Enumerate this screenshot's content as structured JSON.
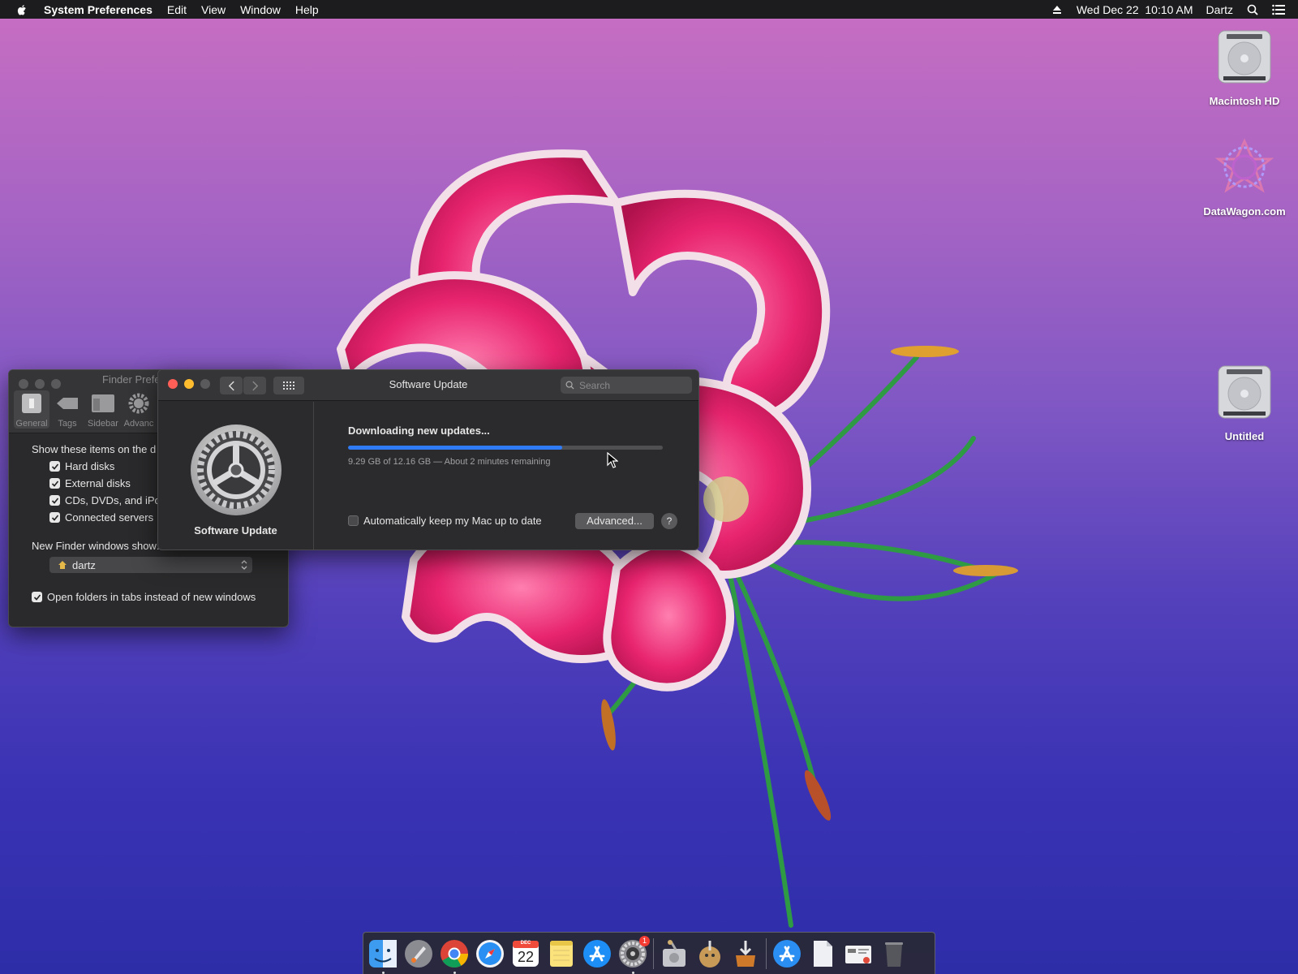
{
  "menubar": {
    "app_name": "System Preferences",
    "items": [
      "Edit",
      "View",
      "Window",
      "Help"
    ],
    "datetime": "Wed Dec 22  10:10 AM",
    "user": "Dartz"
  },
  "desktop": {
    "icons": [
      {
        "label": "Macintosh HD",
        "icon": "hard-drive-icon"
      },
      {
        "label": "DataWagon.com",
        "icon": "datawagon-logo-icon"
      },
      {
        "label": "Untitled",
        "icon": "hard-drive-icon"
      }
    ]
  },
  "finder_prefs": {
    "title": "Finder Prefe",
    "tabs": [
      "General",
      "Tags",
      "Sidebar",
      "Advanc"
    ],
    "show_items_label": "Show these items on the d",
    "checkboxes": [
      {
        "label": "Hard disks",
        "checked": true
      },
      {
        "label": "External disks",
        "checked": true
      },
      {
        "label": "CDs, DVDs, and iPo",
        "checked": true
      },
      {
        "label": "Connected servers",
        "checked": true
      }
    ],
    "new_window_label": "New Finder windows show:",
    "new_window_value": "dartz",
    "tabs_checkbox_label": "Open folders in tabs instead of new windows"
  },
  "software_update": {
    "window_title": "Software Update",
    "search_placeholder": "Search",
    "pane_name": "Software Update",
    "status_title": "Downloading new updates...",
    "progress_fraction": 0.68,
    "progress_detail": "9.29 GB of 12.16 GB — About 2 minutes remaining",
    "auto_update_label": "Automatically keep my Mac up to date",
    "auto_update_checked": false,
    "advanced_label": "Advanced...",
    "help_label": "?"
  },
  "dock": {
    "items": [
      {
        "name": "finder-icon",
        "running": true
      },
      {
        "name": "launchpad-icon",
        "running": false
      },
      {
        "name": "chrome-icon",
        "running": true
      },
      {
        "name": "safari-icon",
        "running": false
      },
      {
        "name": "calendar-icon",
        "running": false,
        "month": "DEC",
        "day": "22"
      },
      {
        "name": "notes-icon",
        "running": false
      },
      {
        "name": "app-store-icon",
        "running": false
      },
      {
        "name": "system-preferences-icon",
        "running": true,
        "badge": "1"
      },
      {
        "name": "disk-utility-icon",
        "running": false
      },
      {
        "name": "installer-icon",
        "running": false
      },
      {
        "name": "disk-installer-icon",
        "running": false
      },
      {
        "name": "app-store-downloads-icon",
        "running": false
      },
      {
        "name": "document-icon",
        "running": false
      },
      {
        "name": "network-icon",
        "running": false
      },
      {
        "name": "trash-icon",
        "running": false
      }
    ]
  },
  "colors": {
    "progress": "#2f7bf5",
    "close": "#ff5f57",
    "minimize": "#febc2e",
    "disabled": "#5a5a5c"
  }
}
